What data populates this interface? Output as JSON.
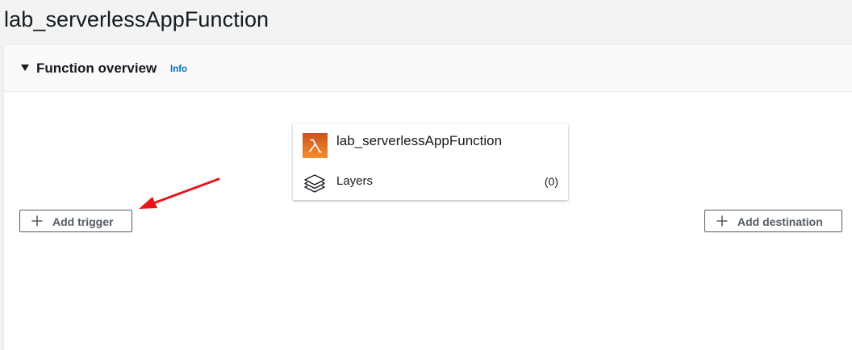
{
  "page": {
    "title": "lab_serverlessAppFunction"
  },
  "overview": {
    "title": "Function overview",
    "info_label": "Info"
  },
  "function_card": {
    "name": "lab_serverlessAppFunction",
    "icon": "lambda-icon",
    "layers_label": "Layers",
    "layers_count": "(0)",
    "layers_icon": "layers-icon"
  },
  "actions": {
    "add_trigger_label": "Add trigger",
    "add_destination_label": "Add destination"
  },
  "colors": {
    "lambda_orange": "#e37a1b",
    "link_blue": "#0073bb",
    "annotation_arrow_red": "#e8161b"
  }
}
